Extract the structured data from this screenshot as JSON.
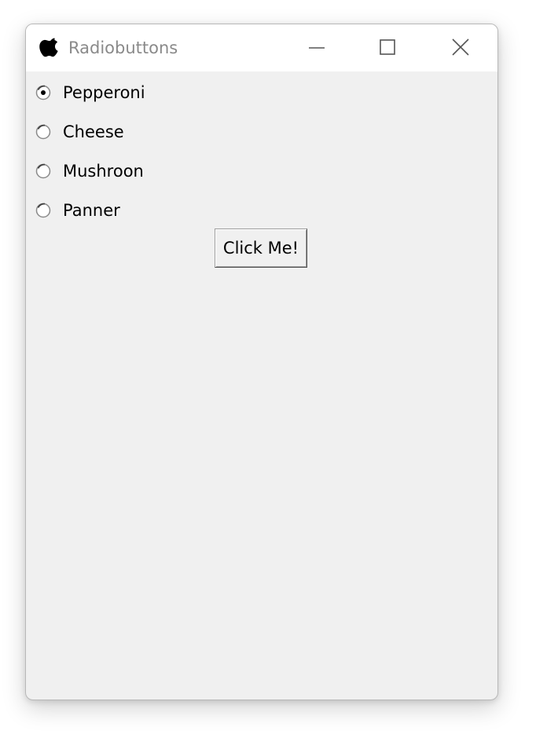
{
  "window": {
    "title": "Radiobuttons"
  },
  "titlebar": {
    "minimize_icon": "minimize-icon",
    "maximize_icon": "maximize-icon",
    "close_icon": "close-icon"
  },
  "radios": {
    "selected": "Pepperoni",
    "options": [
      {
        "label": "Pepperoni",
        "checked": true
      },
      {
        "label": "Cheese",
        "checked": false
      },
      {
        "label": "Mushroon",
        "checked": false
      },
      {
        "label": "Panner",
        "checked": false
      }
    ]
  },
  "button": {
    "label": "Click Me!"
  }
}
